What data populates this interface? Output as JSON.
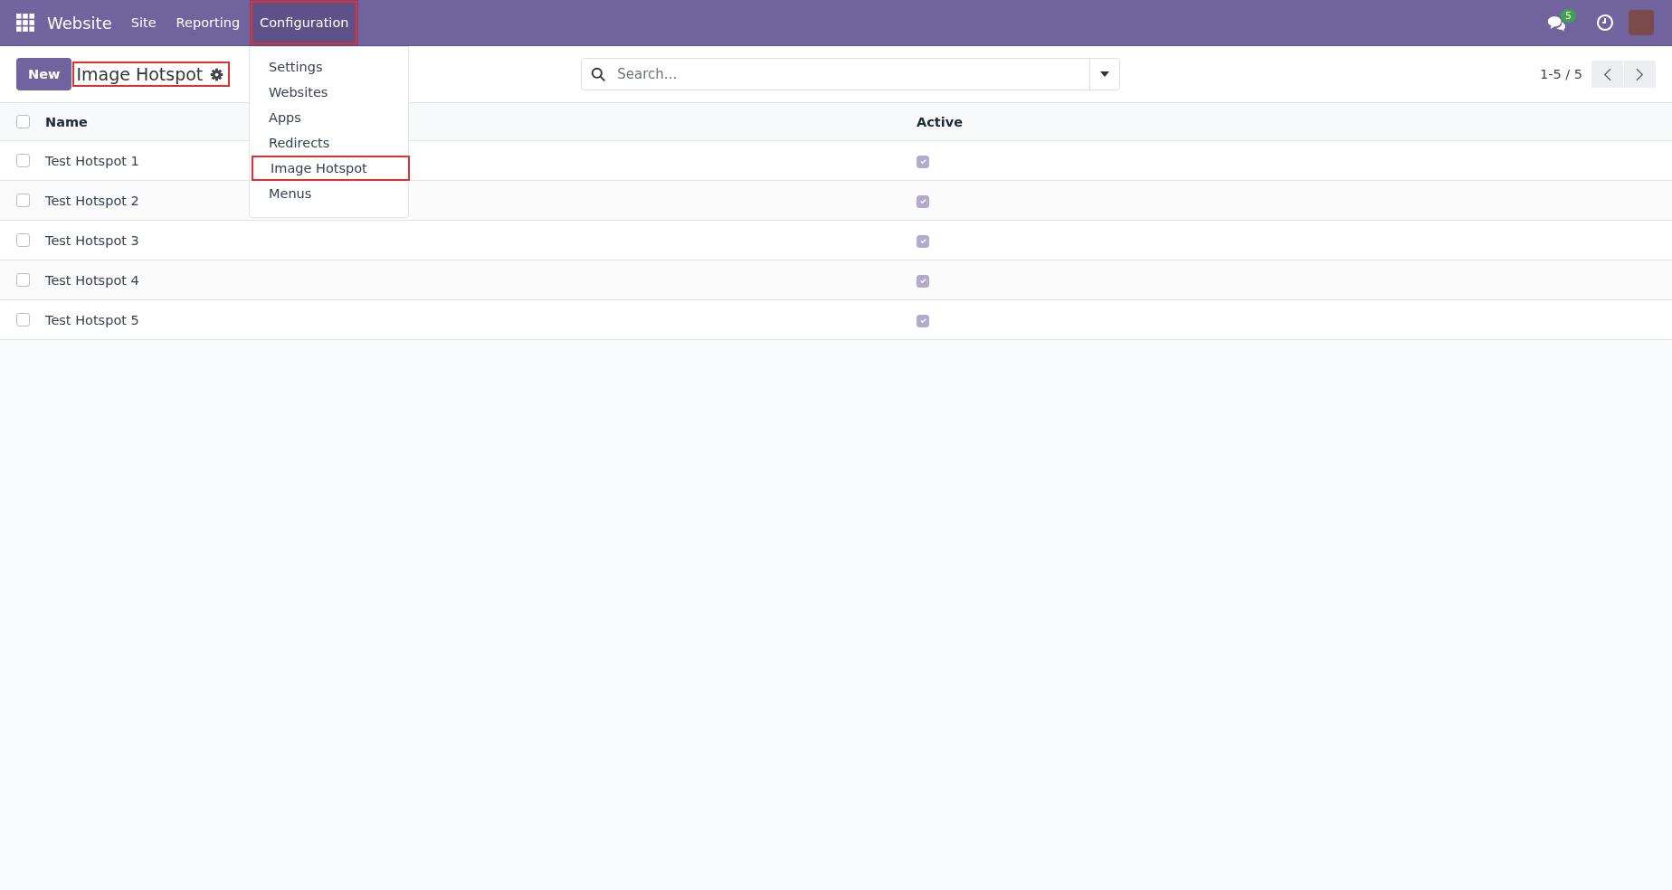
{
  "navbar": {
    "app_name": "Website",
    "menus": [
      {
        "label": "Site",
        "open": false,
        "highlighted": false
      },
      {
        "label": "Reporting",
        "open": false,
        "highlighted": false
      },
      {
        "label": "Configuration",
        "open": true,
        "highlighted": true
      }
    ],
    "messages_badge": "5"
  },
  "dropdown": {
    "items": [
      {
        "label": "Settings",
        "highlighted": false
      },
      {
        "label": "Websites",
        "highlighted": false
      },
      {
        "label": "Apps",
        "highlighted": false
      },
      {
        "label": "Redirects",
        "highlighted": false
      },
      {
        "label": "Image Hotspot",
        "highlighted": true
      },
      {
        "label": "Menus",
        "highlighted": false
      }
    ]
  },
  "control_panel": {
    "new_button": "New",
    "title": "Image Hotspot",
    "title_highlighted": true,
    "search": {
      "placeholder": "Search..."
    },
    "pager": "1-5 / 5"
  },
  "table": {
    "columns": [
      "Name",
      "Active"
    ],
    "all_selected": false,
    "rows": [
      {
        "name": "Test Hotspot 1",
        "selected": false,
        "active": true
      },
      {
        "name": "Test Hotspot 2",
        "selected": false,
        "active": true
      },
      {
        "name": "Test Hotspot 3",
        "selected": false,
        "active": true
      },
      {
        "name": "Test Hotspot 4",
        "selected": false,
        "active": true
      },
      {
        "name": "Test Hotspot 5",
        "selected": false,
        "active": true
      }
    ]
  }
}
